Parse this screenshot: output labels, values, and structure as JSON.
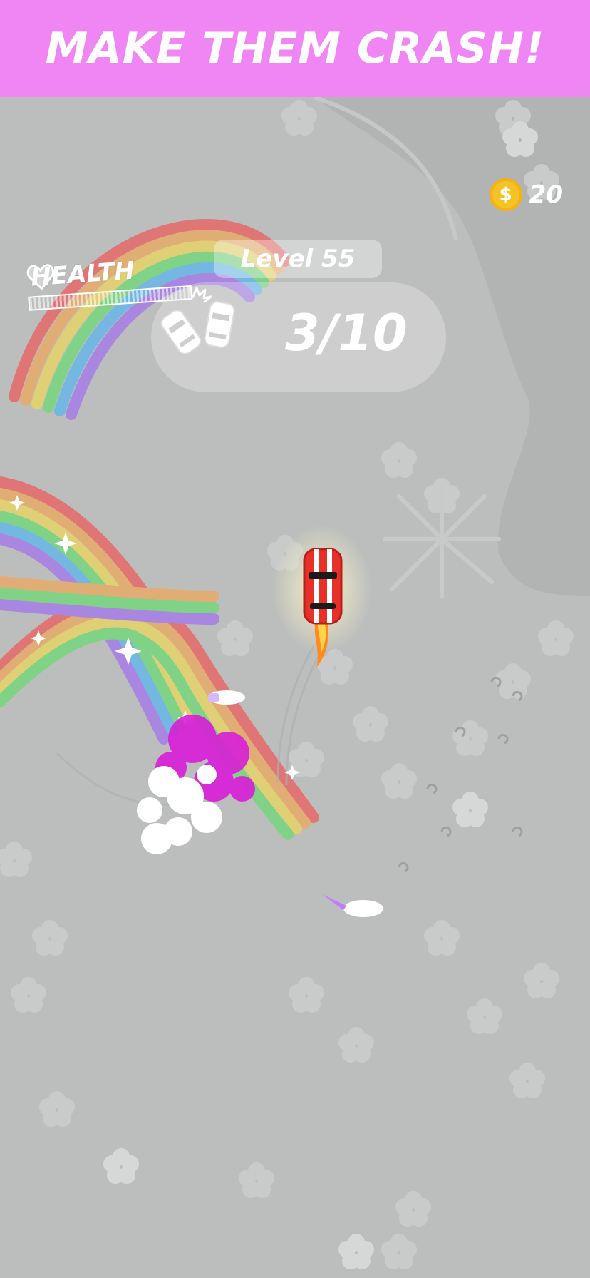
{
  "banner": {
    "title": "MAKE THEM CRASH!"
  },
  "hud": {
    "health_label": "HEALTH",
    "health_icon": "heart-icon",
    "coin_icon": "dollar-coin-icon",
    "coin_symbol": "$",
    "coins": "20",
    "level": "Level 55",
    "crash_icon": "crashed-cars-icon",
    "crash_progress": "3/10"
  },
  "colors": {
    "banner_bg": "#ef86f3",
    "field_bg": "#bcbebd",
    "player_car": "#e8302b",
    "explosion": "#d91dd8",
    "coin": "#f4c326"
  }
}
